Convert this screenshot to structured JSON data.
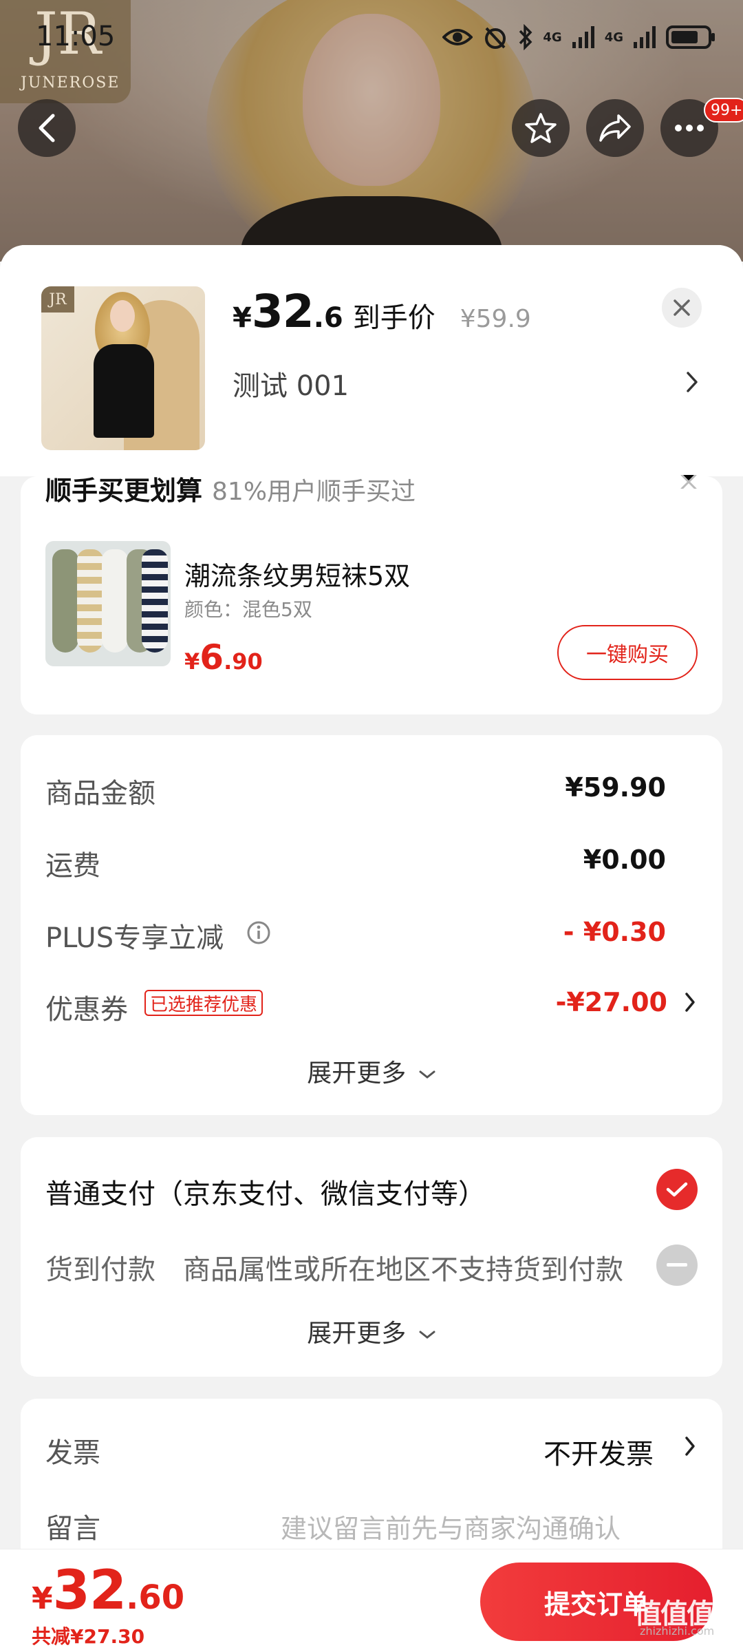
{
  "status_bar": {
    "time": "11:05",
    "signal_1": "4G",
    "signal_2": "4G"
  },
  "brand": {
    "monogram": "JR",
    "name": "JUNEROSE"
  },
  "header": {
    "badge_count": "99+",
    "icons": [
      "back-icon",
      "star-icon",
      "share-icon",
      "more-icon"
    ]
  },
  "product": {
    "currency": "¥",
    "price_int": "32",
    "price_dec": ".6",
    "price_tag": "到手价",
    "original_price": "¥59.9",
    "variant": "测试  001"
  },
  "addon": {
    "title": "顺手买更划算",
    "subtitle": "81%用户顺手买过",
    "name": "潮流条纹男短袜5双",
    "spec": "颜色：混色5双",
    "price_currency": "¥",
    "price_int": "6",
    "price_dec": ".90",
    "buy_label": "一键购买"
  },
  "summary": {
    "rows": [
      {
        "label": "商品金额",
        "value": "¥59.90"
      },
      {
        "label": "运费",
        "value": "¥0.00"
      },
      {
        "label": "PLUS专享立减",
        "value": "- ¥0.30"
      },
      {
        "label": "优惠券",
        "value": "-¥27.00"
      }
    ],
    "coupon_tag": "已选推荐优惠",
    "expand_label": "展开更多"
  },
  "payment": {
    "normal": "普通支付（京东支付、微信支付等）",
    "cod_label": "货到付款",
    "cod_note": "商品属性或所在地区不支持货到付款",
    "expand_label": "展开更多"
  },
  "extra": {
    "invoice_label": "发票",
    "invoice_value": "不开发票",
    "message_label": "留言",
    "message_placeholder": "建议留言前先与商家沟通确认"
  },
  "footer": {
    "currency": "¥",
    "total_int": "32",
    "total_dec": ".60",
    "saved": "共减¥27.30",
    "submit_label": "提交订单"
  },
  "watermark": {
    "text": "值值值",
    "url": "zhizhizhi.com"
  },
  "colors": {
    "accent": "#e2231a",
    "page_bg": "#f2f2f2"
  }
}
